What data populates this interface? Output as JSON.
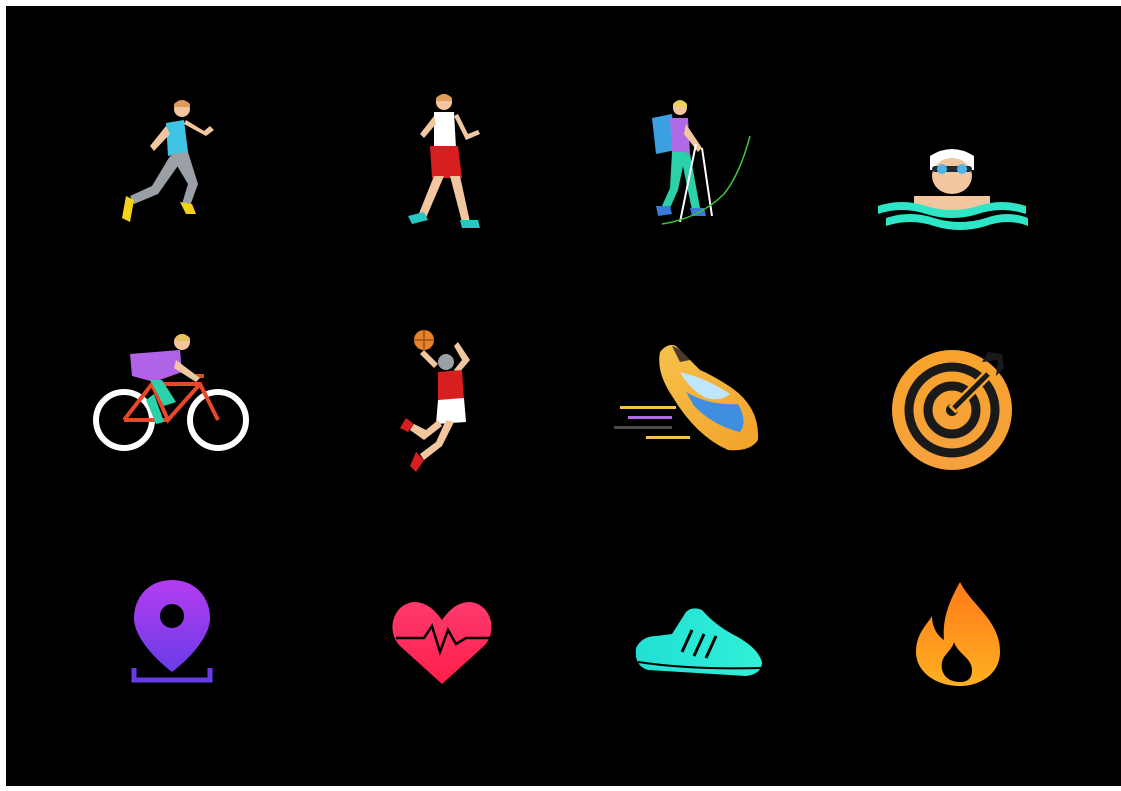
{
  "colors": {
    "background": "#000000"
  },
  "icons": [
    {
      "name": "running-icon"
    },
    {
      "name": "walking-icon"
    },
    {
      "name": "hiking-icon"
    },
    {
      "name": "swimming-icon"
    },
    {
      "name": "cycling-icon"
    },
    {
      "name": "basketball-icon"
    },
    {
      "name": "speed-shoe-icon"
    },
    {
      "name": "target-icon"
    },
    {
      "name": "location-pin-icon"
    },
    {
      "name": "heart-rate-icon"
    },
    {
      "name": "sneaker-icon"
    },
    {
      "name": "flame-icon"
    }
  ]
}
